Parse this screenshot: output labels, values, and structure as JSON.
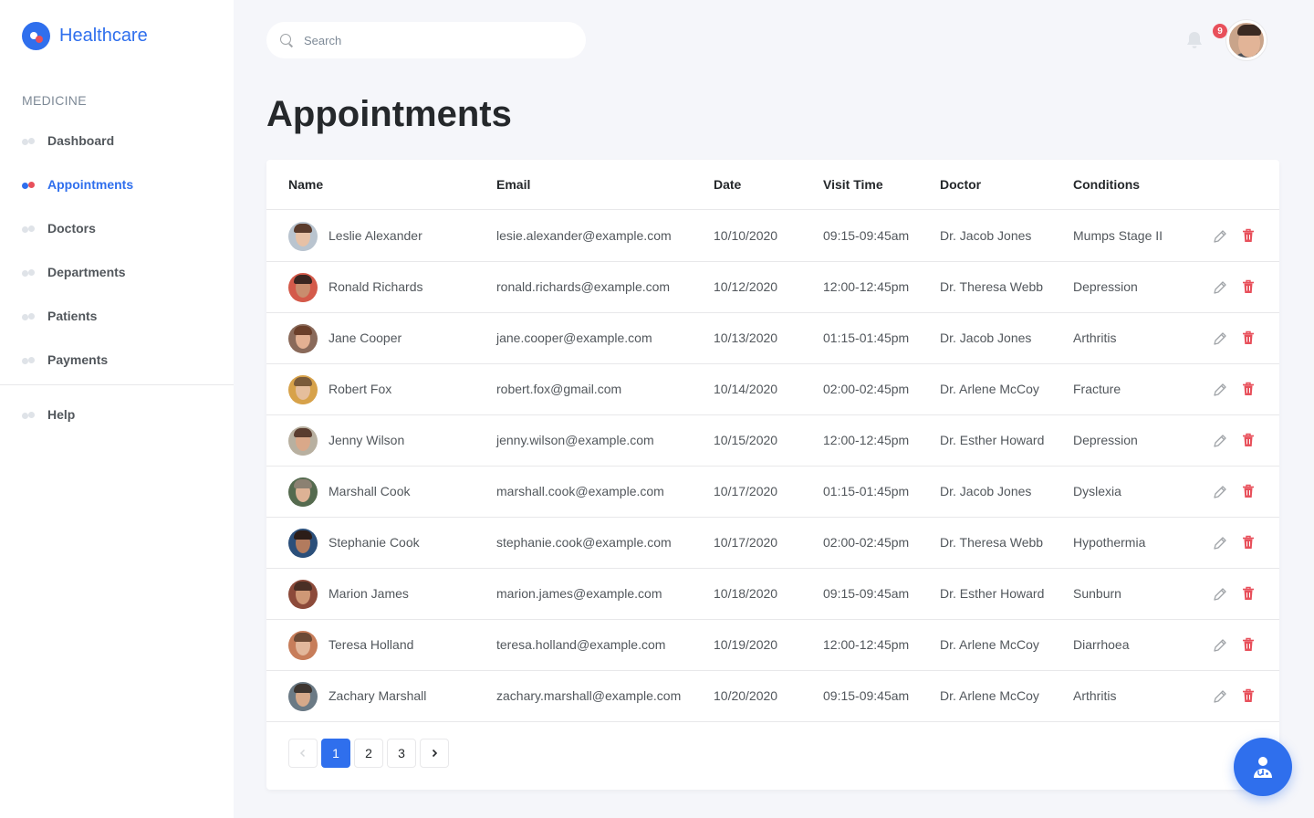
{
  "brand": {
    "name": "Healthcare"
  },
  "sidebar": {
    "section_label": "MEDICINE",
    "items": [
      {
        "label": "Dashboard",
        "active": false
      },
      {
        "label": "Appointments",
        "active": true
      },
      {
        "label": "Doctors",
        "active": false
      },
      {
        "label": "Departments",
        "active": false
      },
      {
        "label": "Patients",
        "active": false
      },
      {
        "label": "Payments",
        "active": false
      }
    ],
    "help_label": "Help"
  },
  "header": {
    "search_placeholder": "Search",
    "notification_count": "9",
    "icons": {
      "search": "search-icon",
      "notifications": "bell-icon",
      "user": "user-avatar"
    }
  },
  "page": {
    "title": "Appointments"
  },
  "table": {
    "columns": [
      "Name",
      "Email",
      "Date",
      "Visit Time",
      "Doctor",
      "Conditions"
    ],
    "rows": [
      {
        "name": "Leslie Alexander",
        "email": "lesie.alexander@example.com",
        "date": "10/10/2020",
        "time": "09:15-09:45am",
        "doctor": "Dr. Jacob Jones",
        "condition": "Mumps Stage II"
      },
      {
        "name": "Ronald Richards",
        "email": "ronald.richards@example.com",
        "date": "10/12/2020",
        "time": "12:00-12:45pm",
        "doctor": "Dr. Theresa Webb",
        "condition": "Depression"
      },
      {
        "name": "Jane Cooper",
        "email": "jane.cooper@example.com",
        "date": "10/13/2020",
        "time": "01:15-01:45pm",
        "doctor": "Dr. Jacob Jones",
        "condition": "Arthritis"
      },
      {
        "name": "Robert Fox",
        "email": "robert.fox@gmail.com",
        "date": "10/14/2020",
        "time": "02:00-02:45pm",
        "doctor": "Dr. Arlene McCoy",
        "condition": "Fracture"
      },
      {
        "name": "Jenny Wilson",
        "email": "jenny.wilson@example.com",
        "date": "10/15/2020",
        "time": "12:00-12:45pm",
        "doctor": "Dr. Esther Howard",
        "condition": "Depression"
      },
      {
        "name": "Marshall Cook",
        "email": "marshall.cook@example.com",
        "date": "10/17/2020",
        "time": "01:15-01:45pm",
        "doctor": "Dr. Jacob Jones",
        "condition": "Dyslexia"
      },
      {
        "name": "Stephanie Cook",
        "email": "stephanie.cook@example.com",
        "date": "10/17/2020",
        "time": "02:00-02:45pm",
        "doctor": "Dr. Theresa Webb",
        "condition": "Hypothermia"
      },
      {
        "name": "Marion James",
        "email": "marion.james@example.com",
        "date": "10/18/2020",
        "time": "09:15-09:45am",
        "doctor": "Dr. Esther Howard",
        "condition": "Sunburn"
      },
      {
        "name": "Teresa Holland",
        "email": "teresa.holland@example.com",
        "date": "10/19/2020",
        "time": "12:00-12:45pm",
        "doctor": "Dr. Arlene McCoy",
        "condition": "Diarrhoea"
      },
      {
        "name": "Zachary Marshall",
        "email": "zachary.marshall@example.com",
        "date": "10/20/2020",
        "time": "09:15-09:45am",
        "doctor": "Dr. Arlene McCoy",
        "condition": "Arthritis"
      }
    ],
    "row_icons": {
      "edit": "pencil-icon",
      "delete": "trash-icon"
    }
  },
  "pagination": {
    "pages": [
      "1",
      "2",
      "3"
    ],
    "current": "1",
    "icons": {
      "prev": "chevron-left-icon",
      "next": "chevron-right-icon"
    }
  },
  "fab": {
    "icon": "doctor-icon"
  },
  "colors": {
    "accent": "#2f6fed",
    "danger": "#e8505b",
    "text_primary": "#25282b",
    "text_secondary": "#52575c",
    "muted": "#7e8a97",
    "background": "#f5f6fa",
    "surface": "#ffffff",
    "divider": "#e8e8ea"
  }
}
